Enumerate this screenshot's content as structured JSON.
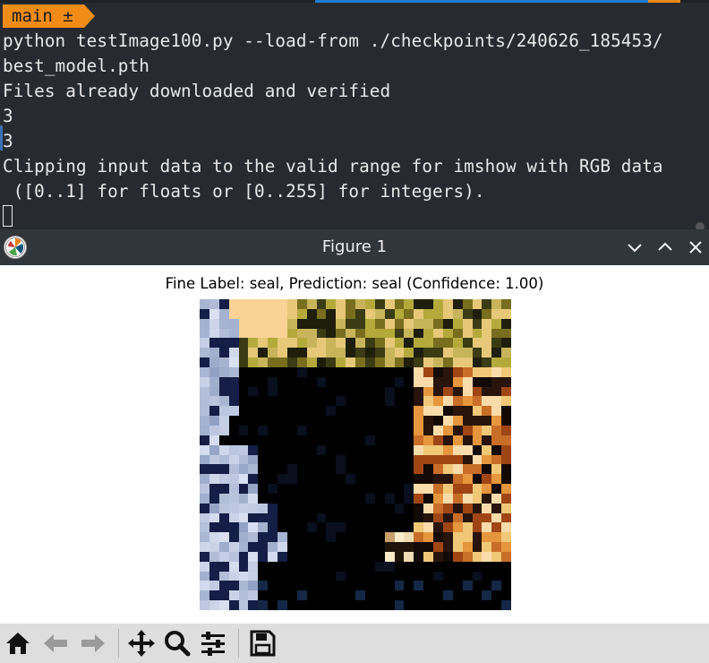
{
  "terminal": {
    "prompt": "main ±",
    "lines": [
      "python testImage100.py --load-from ./checkpoints/240626_185453/",
      "best_model.pth",
      "Files already downloaded and verified",
      "3",
      "3",
      "Clipping input data to the valid range for imshow with RGB data",
      " ([0..1] for floats or [0..255] for integers)."
    ]
  },
  "figure_window": {
    "title": "Figure 1",
    "buttons": [
      "minimize",
      "maximize",
      "close"
    ]
  },
  "plot": {
    "title": "Fine Label: seal, Prediction: seal (Confidence: 1.00)"
  },
  "toolbar": {
    "icons": [
      "home-icon",
      "back-icon",
      "forward-icon",
      "pan-icon",
      "zoom-icon",
      "configure-subplots-icon",
      "save-icon"
    ]
  },
  "colors": {
    "terminal_bg": "#272b30",
    "prompt_bg": "#f08c16",
    "titlebar_bg": "#31363b",
    "toolbar_bg": "#dedede"
  }
}
